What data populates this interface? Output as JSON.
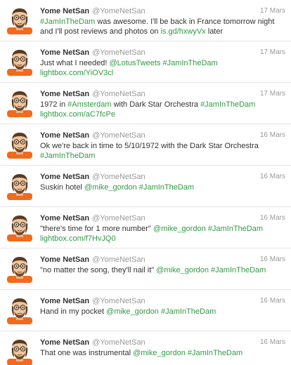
{
  "tweets": [
    {
      "author": "Yome NetSan",
      "handle": "@YomeNetSan",
      "date": "17 Mars",
      "segments": [
        {
          "text": "#JamInTheDam",
          "link": true
        },
        {
          "text": " was awesome. I'll be back in France tomorrow night and I'll post reviews and photos on ",
          "link": false
        },
        {
          "text": "is.gd/hxwyVx",
          "link": true
        },
        {
          "text": " later",
          "link": false
        }
      ]
    },
    {
      "author": "Yome NetSan",
      "handle": "@YomeNetSan",
      "date": "17 Mars",
      "segments": [
        {
          "text": "Just what I needed! ",
          "link": false
        },
        {
          "text": "@LotusTweets",
          "link": true
        },
        {
          "text": " ",
          "link": false
        },
        {
          "text": "#JamInTheDam",
          "link": true
        },
        {
          "text": " ",
          "link": false
        },
        {
          "text": "lightbox.com/YiOV3cl",
          "link": true
        }
      ]
    },
    {
      "author": "Yome NetSan",
      "handle": "@YomeNetSan",
      "date": "17 Mars",
      "segments": [
        {
          "text": "1972 in ",
          "link": false
        },
        {
          "text": "#Amsterdam",
          "link": true
        },
        {
          "text": " with Dark Star Orchestra ",
          "link": false
        },
        {
          "text": "#JamInTheDam",
          "link": true
        },
        {
          "text": " ",
          "link": false
        },
        {
          "text": "lightbox.com/aC7fcPe",
          "link": true
        }
      ]
    },
    {
      "author": "Yome NetSan",
      "handle": "@YomeNetSan",
      "date": "16 Mars",
      "segments": [
        {
          "text": "Ok we're back in time to 5/10/1972 with the Dark Star Orchestra ",
          "link": false
        },
        {
          "text": "#JamInTheDam",
          "link": true
        }
      ]
    },
    {
      "author": "Yome NetSan",
      "handle": "@YomeNetSan",
      "date": "16 Mars",
      "segments": [
        {
          "text": "Suskin hotel ",
          "link": false
        },
        {
          "text": "@mike_gordon",
          "link": true
        },
        {
          "text": " ",
          "link": false
        },
        {
          "text": "#JamInTheDam",
          "link": true
        }
      ]
    },
    {
      "author": "Yome NetSan",
      "handle": "@YomeNetSan",
      "date": "16 Mars",
      "segments": [
        {
          "text": "\"there's time for 1 more number\" ",
          "link": false
        },
        {
          "text": "@mike_gordon",
          "link": true
        },
        {
          "text": " ",
          "link": false
        },
        {
          "text": "#JamInTheDam",
          "link": true
        },
        {
          "text": " ",
          "link": false
        },
        {
          "text": "lightbox.com/f7HvJQ0",
          "link": true
        }
      ]
    },
    {
      "author": "Yome NetSan",
      "handle": "@YomeNetSan",
      "date": "16 Mars",
      "segments": [
        {
          "text": "\"no matter the song, they'll nail it\" ",
          "link": false
        },
        {
          "text": "@mike_gordon",
          "link": true
        },
        {
          "text": " ",
          "link": false
        },
        {
          "text": "#JamInTheDam",
          "link": true
        }
      ]
    },
    {
      "author": "Yome NetSan",
      "handle": "@YomeNetSan",
      "date": "16 Mars",
      "segments": [
        {
          "text": "Hand in my pocket ",
          "link": false
        },
        {
          "text": "@mike_gordon",
          "link": true
        },
        {
          "text": " ",
          "link": false
        },
        {
          "text": "#JamInTheDam",
          "link": true
        }
      ]
    },
    {
      "author": "Yome NetSan",
      "handle": "@YomeNetSan",
      "date": "16 Mars",
      "segments": [
        {
          "text": "That one was instrumental ",
          "link": false
        },
        {
          "text": "@mike_gordon",
          "link": true
        },
        {
          "text": " ",
          "link": false
        },
        {
          "text": "#JamInTheDam",
          "link": true
        }
      ]
    }
  ],
  "colors": {
    "link": "#2f9a44",
    "meta": "#999999",
    "text": "#333333",
    "divider": "#e5e5e5"
  },
  "icons": {
    "avatar": "mii-avatar-icon"
  }
}
